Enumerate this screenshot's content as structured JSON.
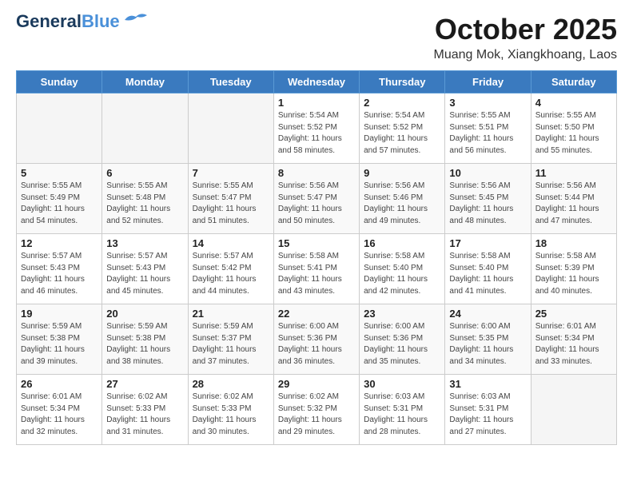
{
  "header": {
    "logo_line1": "General",
    "logo_line2": "Blue",
    "month": "October 2025",
    "location": "Muang Mok, Xiangkhoang, Laos"
  },
  "weekdays": [
    "Sunday",
    "Monday",
    "Tuesday",
    "Wednesday",
    "Thursday",
    "Friday",
    "Saturday"
  ],
  "weeks": [
    [
      {
        "day": "",
        "info": ""
      },
      {
        "day": "",
        "info": ""
      },
      {
        "day": "",
        "info": ""
      },
      {
        "day": "1",
        "info": "Sunrise: 5:54 AM\nSunset: 5:52 PM\nDaylight: 11 hours\nand 58 minutes."
      },
      {
        "day": "2",
        "info": "Sunrise: 5:54 AM\nSunset: 5:52 PM\nDaylight: 11 hours\nand 57 minutes."
      },
      {
        "day": "3",
        "info": "Sunrise: 5:55 AM\nSunset: 5:51 PM\nDaylight: 11 hours\nand 56 minutes."
      },
      {
        "day": "4",
        "info": "Sunrise: 5:55 AM\nSunset: 5:50 PM\nDaylight: 11 hours\nand 55 minutes."
      }
    ],
    [
      {
        "day": "5",
        "info": "Sunrise: 5:55 AM\nSunset: 5:49 PM\nDaylight: 11 hours\nand 54 minutes."
      },
      {
        "day": "6",
        "info": "Sunrise: 5:55 AM\nSunset: 5:48 PM\nDaylight: 11 hours\nand 52 minutes."
      },
      {
        "day": "7",
        "info": "Sunrise: 5:55 AM\nSunset: 5:47 PM\nDaylight: 11 hours\nand 51 minutes."
      },
      {
        "day": "8",
        "info": "Sunrise: 5:56 AM\nSunset: 5:47 PM\nDaylight: 11 hours\nand 50 minutes."
      },
      {
        "day": "9",
        "info": "Sunrise: 5:56 AM\nSunset: 5:46 PM\nDaylight: 11 hours\nand 49 minutes."
      },
      {
        "day": "10",
        "info": "Sunrise: 5:56 AM\nSunset: 5:45 PM\nDaylight: 11 hours\nand 48 minutes."
      },
      {
        "day": "11",
        "info": "Sunrise: 5:56 AM\nSunset: 5:44 PM\nDaylight: 11 hours\nand 47 minutes."
      }
    ],
    [
      {
        "day": "12",
        "info": "Sunrise: 5:57 AM\nSunset: 5:43 PM\nDaylight: 11 hours\nand 46 minutes."
      },
      {
        "day": "13",
        "info": "Sunrise: 5:57 AM\nSunset: 5:43 PM\nDaylight: 11 hours\nand 45 minutes."
      },
      {
        "day": "14",
        "info": "Sunrise: 5:57 AM\nSunset: 5:42 PM\nDaylight: 11 hours\nand 44 minutes."
      },
      {
        "day": "15",
        "info": "Sunrise: 5:58 AM\nSunset: 5:41 PM\nDaylight: 11 hours\nand 43 minutes."
      },
      {
        "day": "16",
        "info": "Sunrise: 5:58 AM\nSunset: 5:40 PM\nDaylight: 11 hours\nand 42 minutes."
      },
      {
        "day": "17",
        "info": "Sunrise: 5:58 AM\nSunset: 5:40 PM\nDaylight: 11 hours\nand 41 minutes."
      },
      {
        "day": "18",
        "info": "Sunrise: 5:58 AM\nSunset: 5:39 PM\nDaylight: 11 hours\nand 40 minutes."
      }
    ],
    [
      {
        "day": "19",
        "info": "Sunrise: 5:59 AM\nSunset: 5:38 PM\nDaylight: 11 hours\nand 39 minutes."
      },
      {
        "day": "20",
        "info": "Sunrise: 5:59 AM\nSunset: 5:38 PM\nDaylight: 11 hours\nand 38 minutes."
      },
      {
        "day": "21",
        "info": "Sunrise: 5:59 AM\nSunset: 5:37 PM\nDaylight: 11 hours\nand 37 minutes."
      },
      {
        "day": "22",
        "info": "Sunrise: 6:00 AM\nSunset: 5:36 PM\nDaylight: 11 hours\nand 36 minutes."
      },
      {
        "day": "23",
        "info": "Sunrise: 6:00 AM\nSunset: 5:36 PM\nDaylight: 11 hours\nand 35 minutes."
      },
      {
        "day": "24",
        "info": "Sunrise: 6:00 AM\nSunset: 5:35 PM\nDaylight: 11 hours\nand 34 minutes."
      },
      {
        "day": "25",
        "info": "Sunrise: 6:01 AM\nSunset: 5:34 PM\nDaylight: 11 hours\nand 33 minutes."
      }
    ],
    [
      {
        "day": "26",
        "info": "Sunrise: 6:01 AM\nSunset: 5:34 PM\nDaylight: 11 hours\nand 32 minutes."
      },
      {
        "day": "27",
        "info": "Sunrise: 6:02 AM\nSunset: 5:33 PM\nDaylight: 11 hours\nand 31 minutes."
      },
      {
        "day": "28",
        "info": "Sunrise: 6:02 AM\nSunset: 5:33 PM\nDaylight: 11 hours\nand 30 minutes."
      },
      {
        "day": "29",
        "info": "Sunrise: 6:02 AM\nSunset: 5:32 PM\nDaylight: 11 hours\nand 29 minutes."
      },
      {
        "day": "30",
        "info": "Sunrise: 6:03 AM\nSunset: 5:31 PM\nDaylight: 11 hours\nand 28 minutes."
      },
      {
        "day": "31",
        "info": "Sunrise: 6:03 AM\nSunset: 5:31 PM\nDaylight: 11 hours\nand 27 minutes."
      },
      {
        "day": "",
        "info": ""
      }
    ]
  ]
}
